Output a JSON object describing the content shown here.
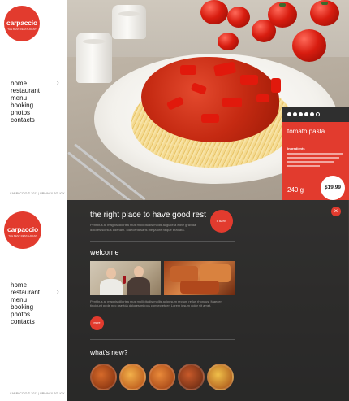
{
  "brand": {
    "name": "carpaccio",
    "tagline": "THE BEST RESTAURANT",
    "accent": "#e23b2e"
  },
  "nav": {
    "items": [
      "home",
      "restaurant",
      "menu",
      "booking",
      "photos",
      "contacts"
    ],
    "arrow_icon": "chevron-right-icon"
  },
  "footer": {
    "text": "CARPACCIO © 2011 | PRIVACY POLICY"
  },
  "dish": {
    "title": "tomato pasta",
    "ingredients_label": "Ingredients",
    "weight": "240 g",
    "price": "$19.99",
    "slider_active": 5,
    "slider_total": 6
  },
  "rest": {
    "heading": "the right place to have good rest",
    "line1": "Pentibus at magnis dilurisa mus mollicitudis mollis augiatera etine gravida",
    "line2": "dolores scesus adenam. Maecentasaris mega ore neque erat ara.",
    "more_label": "more!"
  },
  "welcome": {
    "heading": "welcome",
    "text": "Pentibus at magnis dilurisa mus mollicitudis mollis adipesum rectum rellus rhoncus. Maecen tincidunt pede nec gravida dolores mi pos consectetuer. Lorem ipsum dolor sit amet.",
    "more_label": "more"
  },
  "whats_new": {
    "heading": "what's new?",
    "thumb_count": 5
  },
  "close_icon": "close-icon"
}
